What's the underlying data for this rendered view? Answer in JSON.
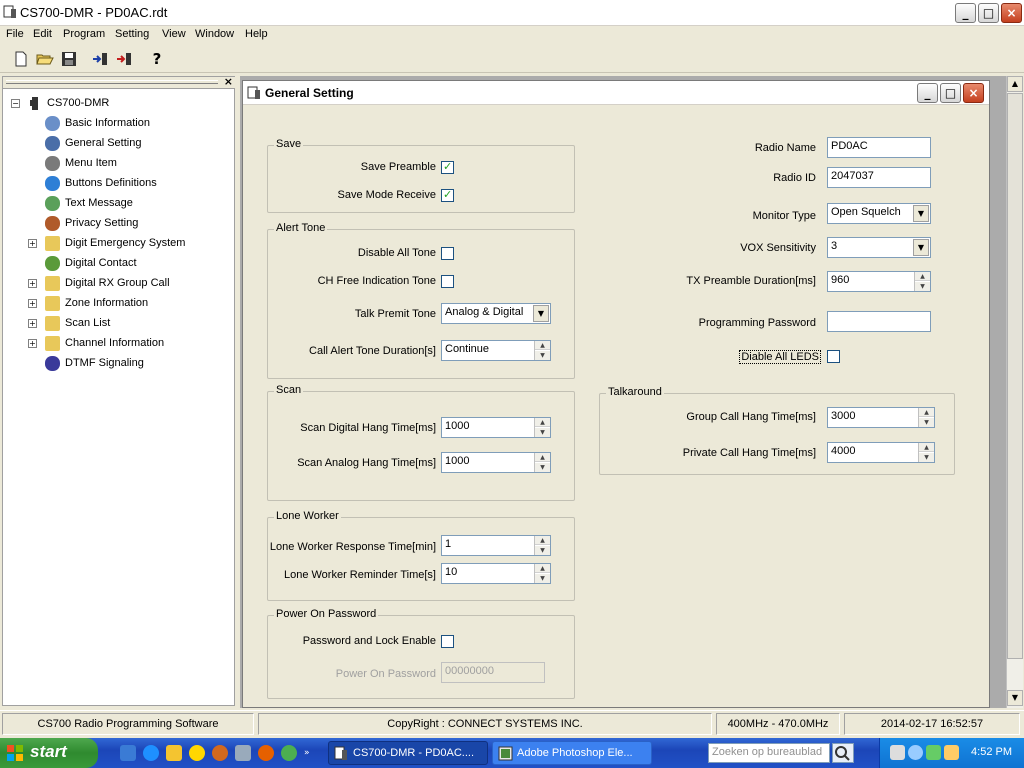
{
  "window": {
    "title": "CS700-DMR - PD0AC.rdt",
    "minimize_label": "_",
    "maximize_label": "□",
    "close_label": "×"
  },
  "menu": [
    "File",
    "Edit",
    "Program",
    "Setting",
    "View",
    "Window",
    "Help"
  ],
  "toolbar": {
    "icons": [
      "new-file-icon",
      "open-folder-icon",
      "save-disk-icon",
      "read-radio-icon",
      "write-radio-icon",
      "help-icon"
    ],
    "help_glyph": "?"
  },
  "tree": {
    "close_label": "×",
    "root": "CS700-DMR",
    "items": [
      {
        "label": "Basic Information",
        "expandable": false
      },
      {
        "label": "General Setting",
        "expandable": false
      },
      {
        "label": "Menu Item",
        "expandable": false
      },
      {
        "label": "Buttons Definitions",
        "expandable": false
      },
      {
        "label": "Text Message",
        "expandable": false
      },
      {
        "label": "Privacy Setting",
        "expandable": false
      },
      {
        "label": "Digit Emergency System",
        "expandable": true
      },
      {
        "label": "Digital Contact",
        "expandable": false
      },
      {
        "label": "Digital RX Group Call",
        "expandable": true
      },
      {
        "label": "Zone Information",
        "expandable": true
      },
      {
        "label": "Scan List",
        "expandable": true
      },
      {
        "label": "Channel Information",
        "expandable": true
      },
      {
        "label": "DTMF Signaling",
        "expandable": false
      }
    ]
  },
  "child": {
    "title": "General Setting",
    "save": {
      "title": "Save",
      "save_preamble_label": "Save Preamble",
      "save_preamble": true,
      "save_mode_receive_label": "Save Mode Receive",
      "save_mode_receive": true
    },
    "alert_tone": {
      "title": "Alert Tone",
      "disable_all_tone_label": "Disable All Tone",
      "ch_free_label": "CH Free Indication Tone",
      "talk_permit_label": "Talk Premit Tone",
      "talk_permit_value": "Analog & Digital",
      "call_alert_label": "Call Alert Tone Duration[s]",
      "call_alert_value": "Continue"
    },
    "scan": {
      "title": "Scan",
      "digital_label": "Scan Digital Hang Time[ms]",
      "digital_value": "1000",
      "analog_label": "Scan Analog Hang Time[ms]",
      "analog_value": "1000"
    },
    "lone_worker": {
      "title": "Lone Worker",
      "response_label": "Lone Worker Response Time[min]",
      "response_value": "1",
      "reminder_label": "Lone Worker Reminder Time[s]",
      "reminder_value": "10"
    },
    "power_on": {
      "title": "Power On Password",
      "lock_label": "Password and Lock Enable",
      "password_label": "Power On Password",
      "password_value": "00000000"
    },
    "radio": {
      "name_label": "Radio Name",
      "name_value": "PD0AC",
      "id_label": "Radio ID",
      "id_value": "2047037",
      "monitor_label": "Monitor Type",
      "monitor_value": "Open Squelch",
      "vox_label": "VOX Sensitivity",
      "vox_value": "3",
      "tx_preamble_label": "TX Preamble Duration[ms]",
      "tx_preamble_value": "960",
      "prog_password_label": "Programming Password",
      "prog_password_value": "",
      "disable_leds_label": "Diable All LEDS"
    },
    "talkaround": {
      "title": "Talkaround",
      "group_label": "Group Call Hang Time[ms]",
      "group_value": "3000",
      "private_label": "Private Call Hang Time[ms]",
      "private_value": "4000"
    },
    "check_glyph": "✓",
    "up_glyph": "▲",
    "down_glyph": "▼"
  },
  "statusbar": {
    "app": "CS700 Radio Programming Software",
    "copyright": "CopyRight : CONNECT SYSTEMS INC.",
    "band": "400MHz - 470.0MHz",
    "datetime": "2014-02-17 16:52:57"
  },
  "taskbar": {
    "start_label": "start",
    "tasks": [
      "CS700-DMR - PD0AC....",
      "Adobe Photoshop Ele..."
    ],
    "search_placeholder": "Zoeken op bureaublad",
    "clock": "4:52 PM"
  },
  "colors": {
    "taskbar_blue": "#2151c6",
    "start_green": "#3a9a3a",
    "tray_blue": "#0f73d2",
    "check_green": "#21a121"
  }
}
